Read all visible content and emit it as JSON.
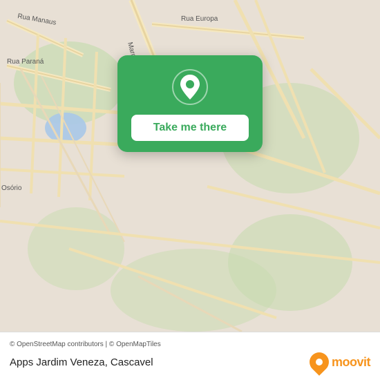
{
  "map": {
    "alt": "Map of Cascavel area"
  },
  "card": {
    "button_label": "Take me there"
  },
  "bottom_bar": {
    "attribution": "© OpenStreetMap contributors | © OpenMapTiles",
    "app_title": "Apps Jardim Veneza, Cascavel",
    "moovit_text": "moovit"
  }
}
